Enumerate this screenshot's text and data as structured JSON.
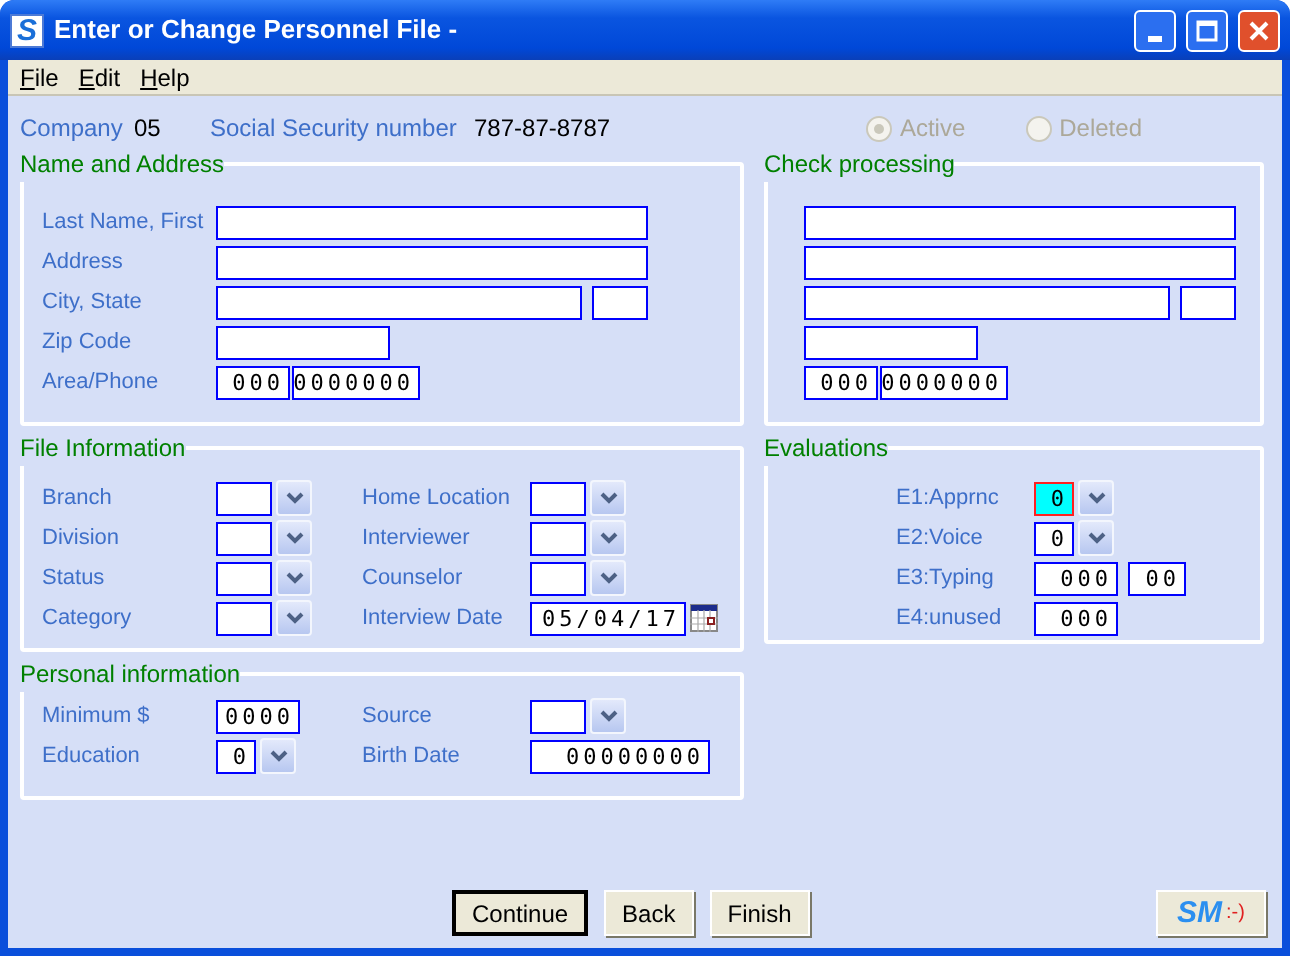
{
  "window": {
    "title": "Enter or Change Personnel File -",
    "app_icon": "S"
  },
  "menu": [
    {
      "label": "File"
    },
    {
      "label": "Edit"
    },
    {
      "label": "Help"
    }
  ],
  "header": {
    "company_label": "Company",
    "company": "05",
    "ssn_label": "Social Security number",
    "ssn": "787-87-8787"
  },
  "status_options": [
    {
      "label": "Active",
      "selected": true,
      "disabled": true
    },
    {
      "label": "Deleted",
      "selected": false,
      "disabled": true
    }
  ],
  "name_and_address": {
    "title": "Name and Address",
    "rows": [
      {
        "label": "Last Name, First",
        "fields": [
          {
            "kind": "wide"
          }
        ]
      },
      {
        "label": "Address",
        "fields": [
          {
            "kind": "wide"
          }
        ]
      },
      {
        "label": "City, State",
        "fields": [
          {
            "kind": "city"
          },
          {
            "kind": "state"
          }
        ]
      },
      {
        "label": "Zip Code",
        "fields": [
          {
            "kind": "zip"
          }
        ]
      },
      {
        "label": "Area/Phone",
        "fields": [
          {
            "kind": "area",
            "value": "000"
          },
          {
            "kind": "phone",
            "value": "0000000"
          }
        ]
      }
    ]
  },
  "check_processing": {
    "title": "Check processing",
    "rows": [
      {
        "fields": [
          {
            "kind": "wide"
          }
        ]
      },
      {
        "fields": [
          {
            "kind": "wide"
          }
        ]
      },
      {
        "fields": [
          {
            "kind": "city"
          },
          {
            "kind": "state"
          }
        ]
      },
      {
        "fields": [
          {
            "kind": "zip"
          }
        ]
      },
      {
        "fields": [
          {
            "kind": "area",
            "value": "000"
          },
          {
            "kind": "phone",
            "value": "0000000"
          }
        ]
      }
    ]
  },
  "file_information": {
    "title": "File Information",
    "left": [
      {
        "label": "Branch",
        "kind": "dropdown"
      },
      {
        "label": "Division",
        "kind": "dropdown"
      },
      {
        "label": "Status",
        "kind": "dropdown"
      },
      {
        "label": "Category",
        "kind": "dropdown"
      }
    ],
    "right": [
      {
        "label": "Home Location",
        "kind": "dropdown"
      },
      {
        "label": "Interviewer",
        "kind": "dropdown"
      },
      {
        "label": "Counselor",
        "kind": "dropdown"
      },
      {
        "label": "Interview Date",
        "kind": "date",
        "value": "05/04/17"
      }
    ]
  },
  "evaluations": {
    "title": "Evaluations",
    "rows": [
      {
        "label": "E1:Apprnc",
        "fields": [
          {
            "kind": "digit_dropdown",
            "value": "0",
            "focused": true
          }
        ]
      },
      {
        "label": "E2:Voice",
        "fields": [
          {
            "kind": "digit_dropdown",
            "value": "0",
            "focused": false
          }
        ]
      },
      {
        "label": "E3:Typing",
        "fields": [
          {
            "kind": "digit3",
            "value": "000",
            "focused": false
          },
          {
            "kind": "digit2",
            "value": "00",
            "focused": false
          }
        ]
      },
      {
        "label": "E4:unused",
        "fields": [
          {
            "kind": "digit3",
            "value": "000",
            "focused": false
          }
        ]
      }
    ]
  },
  "personal_information": {
    "title": "Personal information",
    "left": [
      {
        "label": "Minimum $",
        "kind": "number",
        "value": "0000"
      },
      {
        "label": "Education",
        "kind": "small_dropdown",
        "value": "0"
      }
    ],
    "right": [
      {
        "label": "Source",
        "kind": "dropdown"
      },
      {
        "label": "Birth Date",
        "kind": "long_number",
        "value": "00000000"
      }
    ]
  },
  "buttons": [
    {
      "label": "Continue",
      "default": true
    },
    {
      "label": "Back",
      "default": false
    },
    {
      "label": "Finish",
      "default": false
    }
  ],
  "logo_button": {
    "text": "SM",
    "emote": ":-)"
  }
}
